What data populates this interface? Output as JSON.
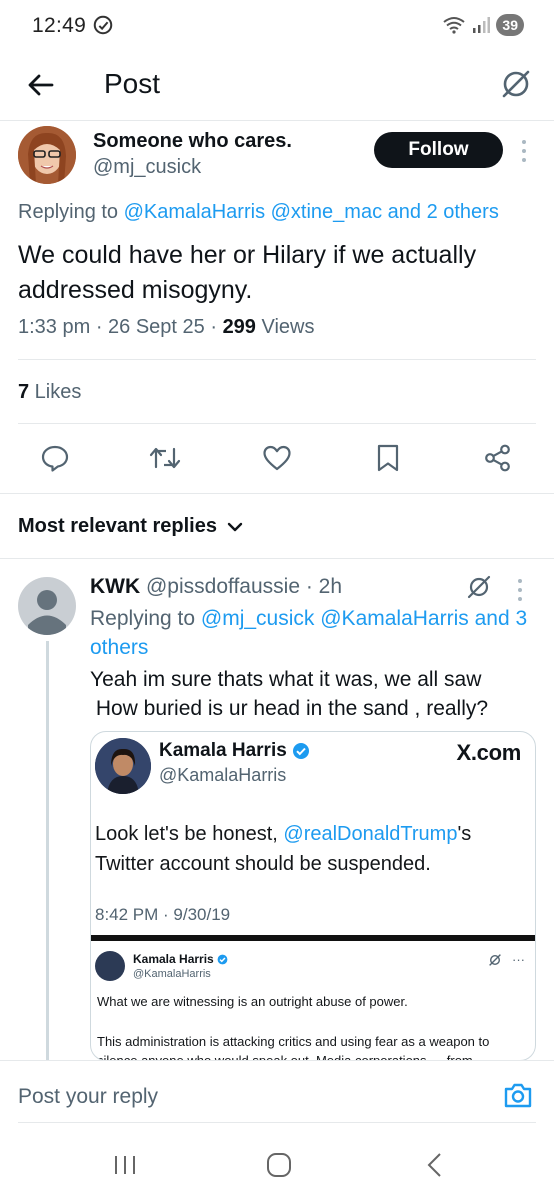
{
  "status": {
    "time": "12:49",
    "battery": "39"
  },
  "header": {
    "title": "Post"
  },
  "post": {
    "author_name": "Someone who cares.",
    "author_handle": "@mj_cusick",
    "follow_label": "Follow",
    "replying_prefix": "Replying to ",
    "replying_links": "@KamalaHarris @xtine_mac and 2 others",
    "text": "We could have her or Hilary if we actually addressed misogyny.",
    "time": "1:33 pm · 26 Sept 25 · ",
    "views_count": "299",
    "views_label": " Views",
    "likes_count": "7",
    "likes_label": " Likes"
  },
  "sort": {
    "label": "Most relevant replies"
  },
  "reply": {
    "name": "KWK",
    "handle_time": " @pissdoffaussie · 2h",
    "replying_prefix": "Replying to ",
    "replying_links": "@mj_cusick @KamalaHarris and 3 others",
    "line1": "Yeah im sure thats what it was, we all saw",
    "line2": " How buried is ur head in the sand , really?"
  },
  "embed": {
    "name": "Kamala Harris",
    "handle": "@KamalaHarris",
    "source": "X.com",
    "text_before": "Look let's be honest, ",
    "text_mention": "@realDonaldTrump",
    "text_after": "'s Twitter account should be suspended.",
    "date": "8:42 PM · 9/30/19",
    "inner_name": "Kamala Harris",
    "inner_handle": "@KamalaHarris",
    "inner_more": "···",
    "inner_line1": "What we are witnessing is an outright abuse of power.",
    "inner_line2": "This administration is attacking critics and using fear as a weapon to silence anyone who would speak out. Media corporations — from"
  },
  "composer": {
    "placeholder": "Post your reply"
  },
  "colors": {
    "accent": "#1d9bf0",
    "text": "#0f1419",
    "muted": "#536471"
  }
}
